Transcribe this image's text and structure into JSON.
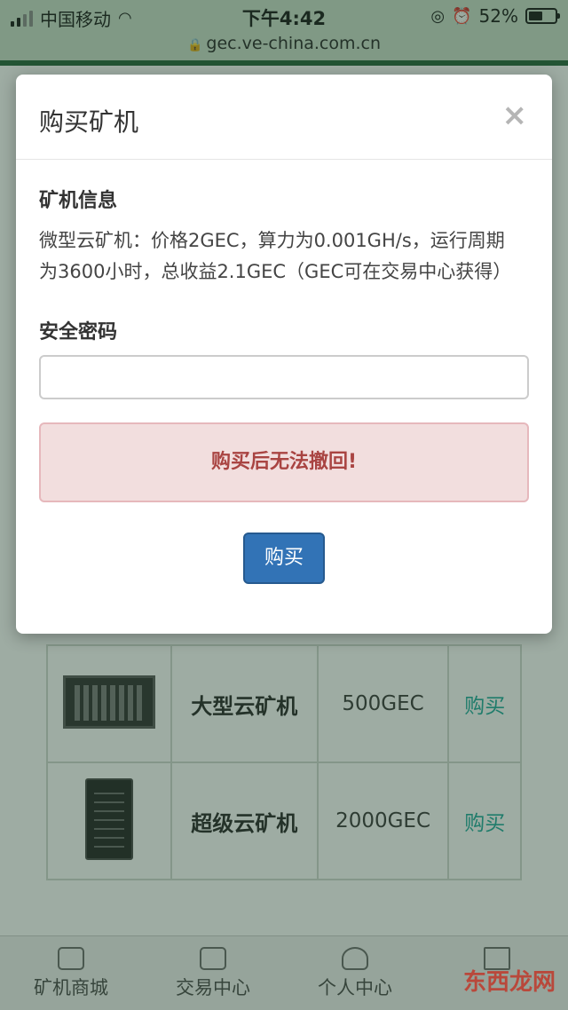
{
  "status_bar": {
    "carrier": "中国移动",
    "time": "下午4:42",
    "battery": "52%"
  },
  "browser": {
    "url": "gec.ve-china.com.cn"
  },
  "products": [
    {
      "name": "大型云矿机",
      "price": "500GEC",
      "action": "购买",
      "image": "large-server"
    },
    {
      "name": "超级云矿机",
      "price": "2000GEC",
      "action": "购买",
      "image": "tower-server"
    }
  ],
  "bottom_nav": [
    {
      "label": "矿机商城",
      "icon": "shop-icon"
    },
    {
      "label": "交易中心",
      "icon": "bag-icon"
    },
    {
      "label": "个人中心",
      "icon": "person-icon"
    },
    {
      "label": "",
      "icon": "home-icon"
    }
  ],
  "watermark": "东西龙网",
  "modal": {
    "title": "购买矿机",
    "close": "×",
    "info_label": "矿机信息",
    "info_text": "微型云矿机：价格2GEC，算力为0.001GH/s，运行周期为3600小时，总收益2.1GEC（GEC可在交易中心获得）",
    "password_label": "安全密码",
    "password_value": "",
    "warning": "购买后无法撤回!",
    "buy_button": "购买"
  },
  "colors": {
    "accent": "#3273b6",
    "alert_bg": "#f2dede",
    "alert_text": "#a94442",
    "buy_link": "#1aa89a",
    "header_green": "#1f5f35"
  }
}
